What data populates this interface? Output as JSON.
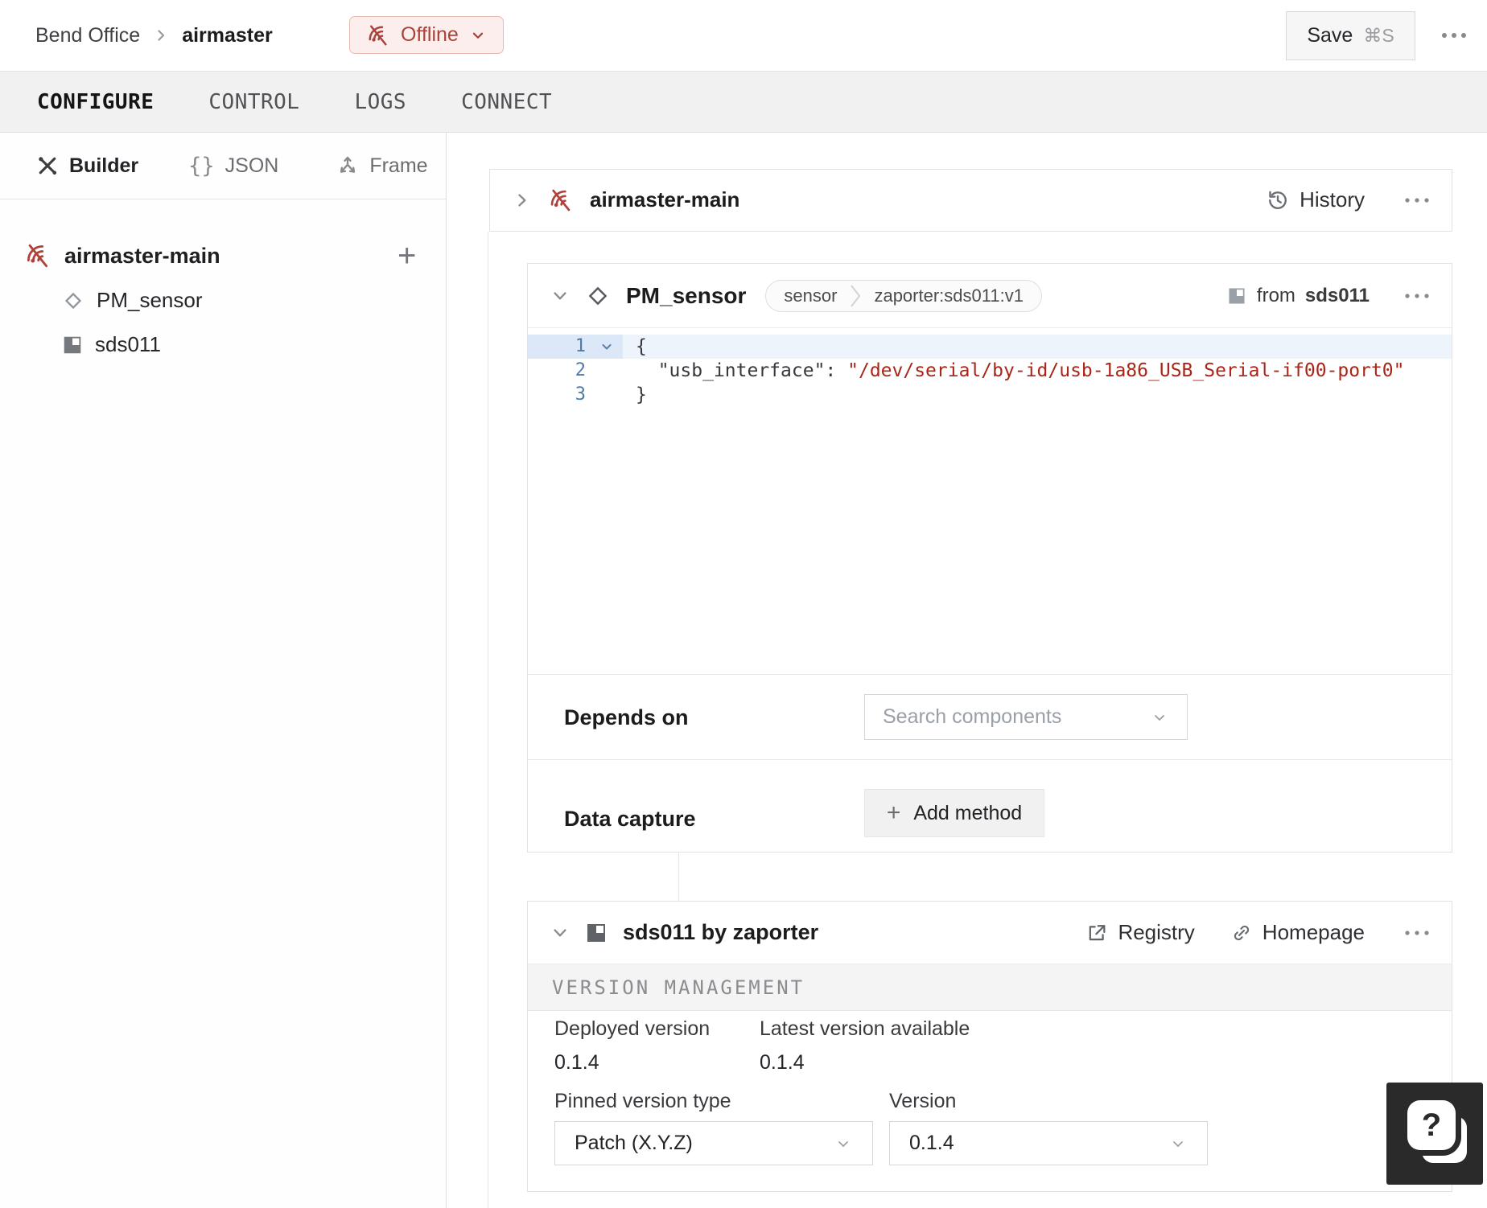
{
  "colors": {
    "offline_red": "#a8423b",
    "code_red": "#ab2418",
    "line_number_blue": "#4d7ba6"
  },
  "header": {
    "breadcrumb": {
      "location": "Bend Office",
      "machine": "airmaster"
    },
    "status_badge": {
      "label": "Offline"
    },
    "save_button": {
      "label": "Save",
      "shortcut": "⌘S"
    }
  },
  "tabs": [
    {
      "label": "CONFIGURE",
      "active": true
    },
    {
      "label": "CONTROL",
      "active": false
    },
    {
      "label": "LOGS",
      "active": false
    },
    {
      "label": "CONNECT",
      "active": false
    }
  ],
  "sidebar": {
    "modes": [
      {
        "label": "Builder"
      },
      {
        "label": "JSON"
      },
      {
        "label": "Frame"
      }
    ],
    "json_icon_glyph": "{}",
    "tree": {
      "part": {
        "label": "airmaster-main",
        "add_button": "+"
      },
      "children": [
        {
          "label": "PM_sensor"
        },
        {
          "label": "sds011"
        }
      ]
    }
  },
  "main": {
    "part_card": {
      "title": "airmaster-main",
      "history_label": "History"
    },
    "component_card": {
      "title": "PM_sensor",
      "type_badge": "sensor",
      "model_badge": "zaporter:sds011:v1",
      "from_label": "from",
      "from_module": "sds011",
      "code": {
        "line_numbers": {
          "n1": "1",
          "n2": "2",
          "n3": "3"
        },
        "line1": "{",
        "line2_indent": "  ",
        "line2_key": "\"usb_interface\"",
        "line2_sep": ": ",
        "line2_value": "\"/dev/serial/by-id/usb-1a86_USB_Serial-if00-port0\"",
        "line3": "}"
      },
      "depends_on": {
        "label": "Depends on",
        "placeholder": "Search components"
      },
      "data_capture": {
        "label": "Data capture",
        "button_plus": "+",
        "button_label": "Add method"
      }
    },
    "module_card": {
      "title": "sds011 by zaporter",
      "registry_label": "Registry",
      "homepage_label": "Homepage",
      "section_title": "VERSION MANAGEMENT",
      "deployed": {
        "label": "Deployed version",
        "value": "0.1.4"
      },
      "latest": {
        "label": "Latest version available",
        "value": "0.1.4"
      },
      "pinned_type": {
        "label": "Pinned version type",
        "value": "Patch (X.Y.Z)"
      },
      "version": {
        "label": "Version",
        "value": "0.1.4"
      }
    }
  },
  "help_button": {
    "glyph": "?"
  }
}
